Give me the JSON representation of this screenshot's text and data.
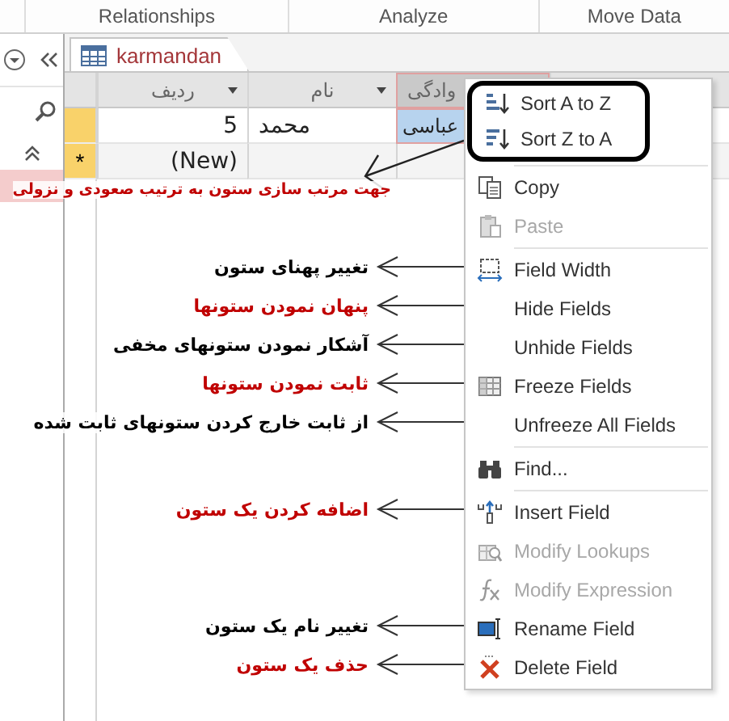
{
  "ribbon_groups": [
    "Move Data",
    "Analyze",
    "Relationships"
  ],
  "document_tab": {
    "title": "karmandan",
    "selected": true
  },
  "table": {
    "columns": [
      {
        "label": "وادگی",
        "selected": true
      },
      {
        "label": "نام",
        "selected": false
      },
      {
        "label": "ردیف",
        "selected": false
      }
    ],
    "rows": [
      {
        "kind": "record",
        "selected": true,
        "cells": [
          "عباسی",
          "محمد",
          "5"
        ]
      },
      {
        "kind": "new",
        "selected": true,
        "marker": "*",
        "label": "(New)"
      }
    ]
  },
  "menu": {
    "groups": [
      {
        "circled": true,
        "annotation": {
          "text": "جهت مرتب سازی ستون به ترتیب صعودی و نزولی",
          "color": "#c00000"
        },
        "items": [
          {
            "label": "Sort A to Z",
            "disabled": false
          },
          {
            "label": "Sort Z to A",
            "disabled": false
          }
        ]
      },
      {
        "items": [
          {
            "label": "Copy",
            "disabled": false
          },
          {
            "label": "Paste",
            "disabled": true
          }
        ]
      },
      {
        "items": [
          {
            "label": "Field Width",
            "disabled": false,
            "annotation": {
              "text": "تغییر پهنای ستون",
              "color": "#000000"
            }
          },
          {
            "label": "Hide Fields",
            "disabled": false,
            "annotation": {
              "text": "پنهان نمودن ستونها",
              "color": "#c00000"
            }
          },
          {
            "label": "Unhide Fields",
            "disabled": false,
            "annotation": {
              "text": "آشکار نمودن ستونهای مخفی",
              "color": "#000000"
            }
          },
          {
            "label": "Freeze Fields",
            "disabled": false,
            "annotation": {
              "text": "ثابت نمودن ستونها",
              "color": "#c00000"
            }
          },
          {
            "label": "Unfreeze All Fields",
            "disabled": false,
            "annotation": {
              "text": "از ثابت خارج کردن ستونهای ثابت شده",
              "color": "#000000"
            }
          }
        ]
      },
      {
        "items": [
          {
            "label": "Find...",
            "disabled": false
          }
        ]
      },
      {
        "items": [
          {
            "label": "Insert Field",
            "disabled": false,
            "annotation": {
              "text": "اضافه کردن یک ستون",
              "color": "#c00000"
            }
          },
          {
            "label": "Modify Lookups",
            "disabled": true
          },
          {
            "label": "Modify Expression",
            "disabled": true
          },
          {
            "label": "Rename Field",
            "disabled": false,
            "annotation": {
              "text": "تغییر نام یک ستون",
              "color": "#000000"
            }
          },
          {
            "label": "Delete Field",
            "disabled": false,
            "annotation": {
              "text": "حذف یک ستون",
              "color": "#c00000"
            }
          }
        ]
      }
    ]
  }
}
